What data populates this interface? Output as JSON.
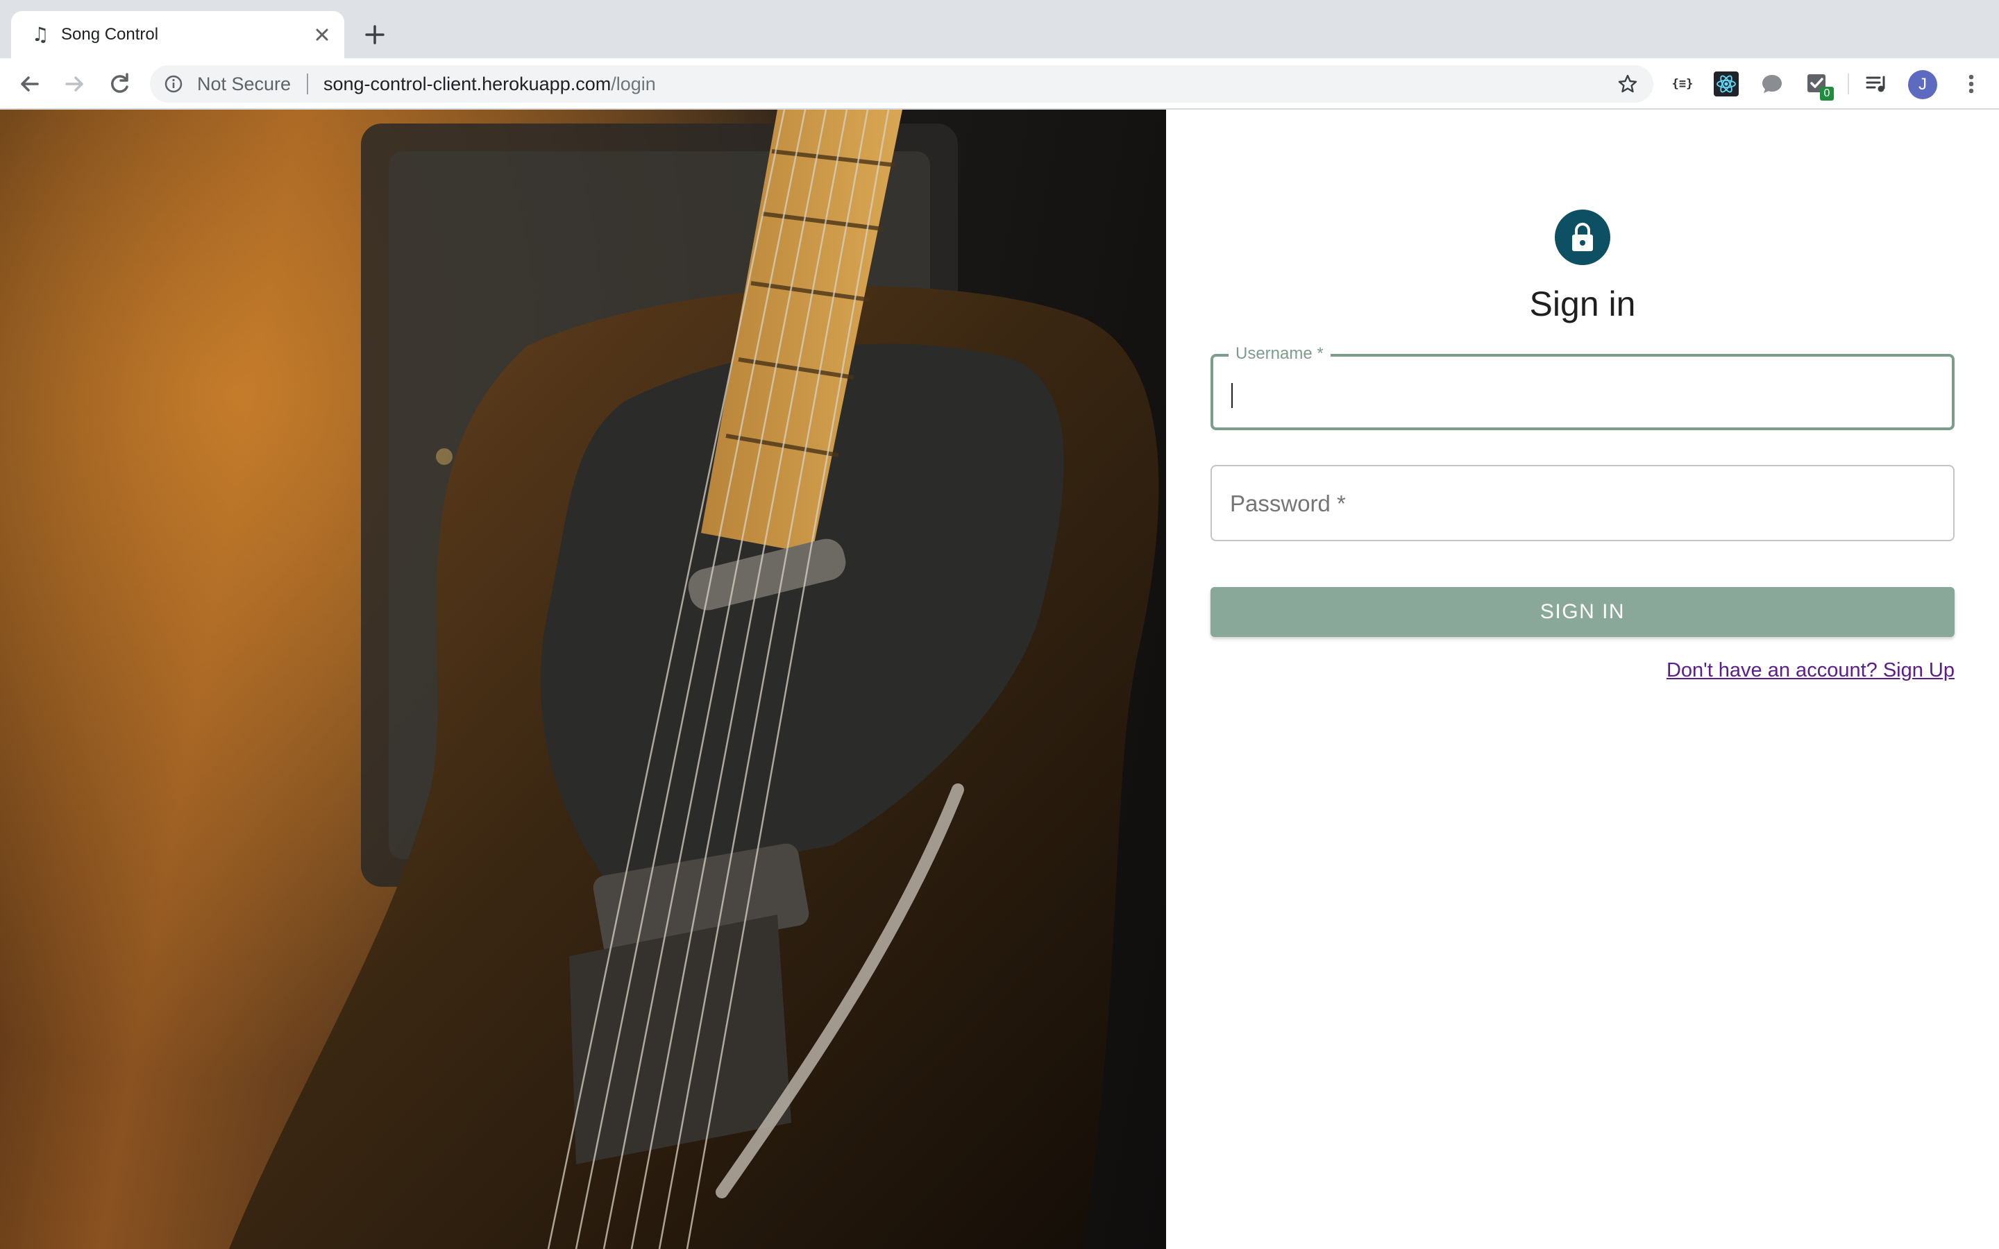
{
  "browser": {
    "tab": {
      "title": "Song Control",
      "favicon": "music-note-icon"
    },
    "omnibox": {
      "security_label": "Not Secure",
      "url_host": "song-control-client.herokuapp.com",
      "url_path": "/login"
    },
    "extensions": {
      "json_label": "{≡}",
      "checklist_badge": "0"
    },
    "profile_initial": "J"
  },
  "page": {
    "hero_image": "electric-guitar-photo",
    "heading": "Sign in",
    "username": {
      "label": "Username *",
      "value": ""
    },
    "password": {
      "label": "Password *",
      "value": ""
    },
    "submit_label": "SIGN IN",
    "signup_link": "Don't have an account? Sign Up",
    "colors": {
      "avatar": "#0d4f63",
      "accent": "#7d9d8c",
      "button": "#8aa899",
      "link": "#5a1e8c"
    }
  }
}
